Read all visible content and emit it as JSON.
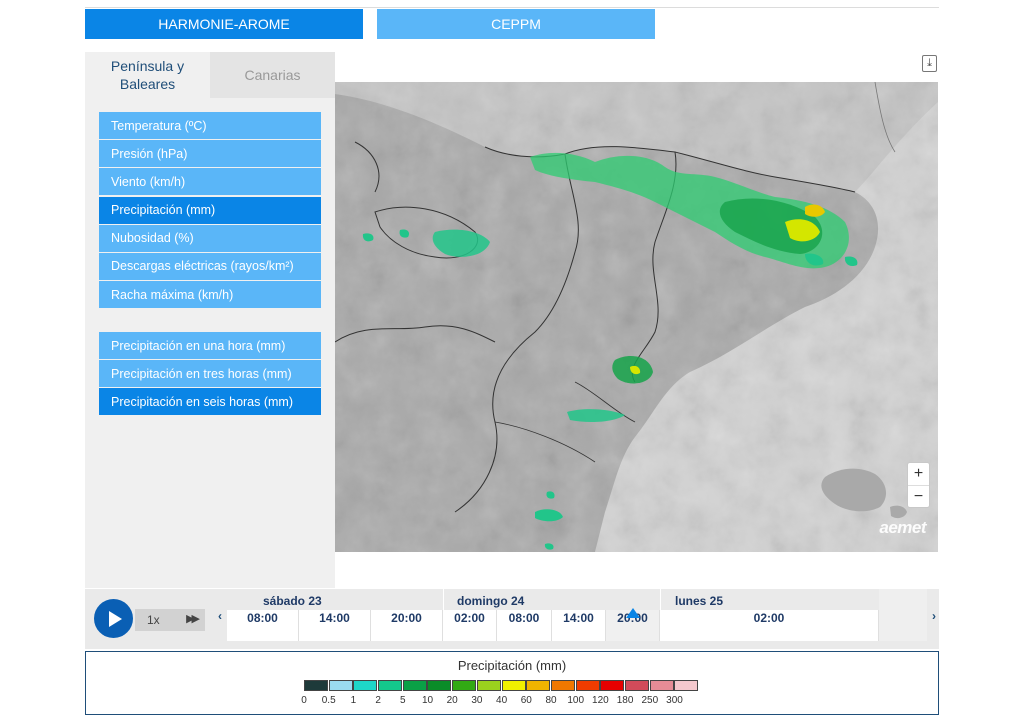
{
  "model_tabs": {
    "harmonie": "HARMONIE-AROME",
    "ceppm": "CEPPM"
  },
  "region_tabs": {
    "active": "Península y Baleares",
    "inactive": "Canarias"
  },
  "variables": [
    {
      "label": "Temperatura (ºC)",
      "selected": false
    },
    {
      "label": "Presión (hPa)",
      "selected": false
    },
    {
      "label": "Viento (km/h)",
      "selected": false
    },
    {
      "label": "Precipitación (mm)",
      "selected": true
    },
    {
      "label": "Nubosidad (%)",
      "selected": false
    },
    {
      "label": "Descargas eléctricas (rayos/km²)",
      "selected": false
    },
    {
      "label": "Racha máxima (km/h)",
      "selected": false
    }
  ],
  "accumulations": [
    {
      "label": "Precipitación en una hora (mm)",
      "selected": false
    },
    {
      "label": "Precipitación en tres horas (mm)",
      "selected": false
    },
    {
      "label": "Precipitación en seis horas (mm)",
      "selected": true
    }
  ],
  "map": {
    "zoom_in": "+",
    "zoom_out": "−",
    "logo": "aemet",
    "download_icon": "download-icon"
  },
  "timeline": {
    "speed": "1x",
    "fast_forward": "▶▶",
    "left_arrow": "‹",
    "right_arrow": "›",
    "days": [
      "sábado 23",
      "domingo 24",
      "lunes 25"
    ],
    "hours": [
      "08:00",
      "14:00",
      "20:00",
      "02:00",
      "08:00",
      "14:00",
      "20:00",
      "02:00"
    ],
    "active_hour_index": 6
  },
  "legend": {
    "title": "Precipitación (mm)",
    "labels": [
      "0",
      "0.5",
      "1",
      "2",
      "5",
      "10",
      "20",
      "30",
      "40",
      "60",
      "80",
      "100",
      "120",
      "180",
      "250",
      "300"
    ],
    "colors": [
      "#1e3a3a",
      "#9adcf0",
      "#1ed7c8",
      "#14c88c",
      "#0aa046",
      "#0a8c28",
      "#32aa14",
      "#9bd21e",
      "#f0f000",
      "#f0b400",
      "#f07800",
      "#f03c00",
      "#e60000",
      "#d24b5a",
      "#e68c96",
      "#f5c8cd"
    ]
  }
}
